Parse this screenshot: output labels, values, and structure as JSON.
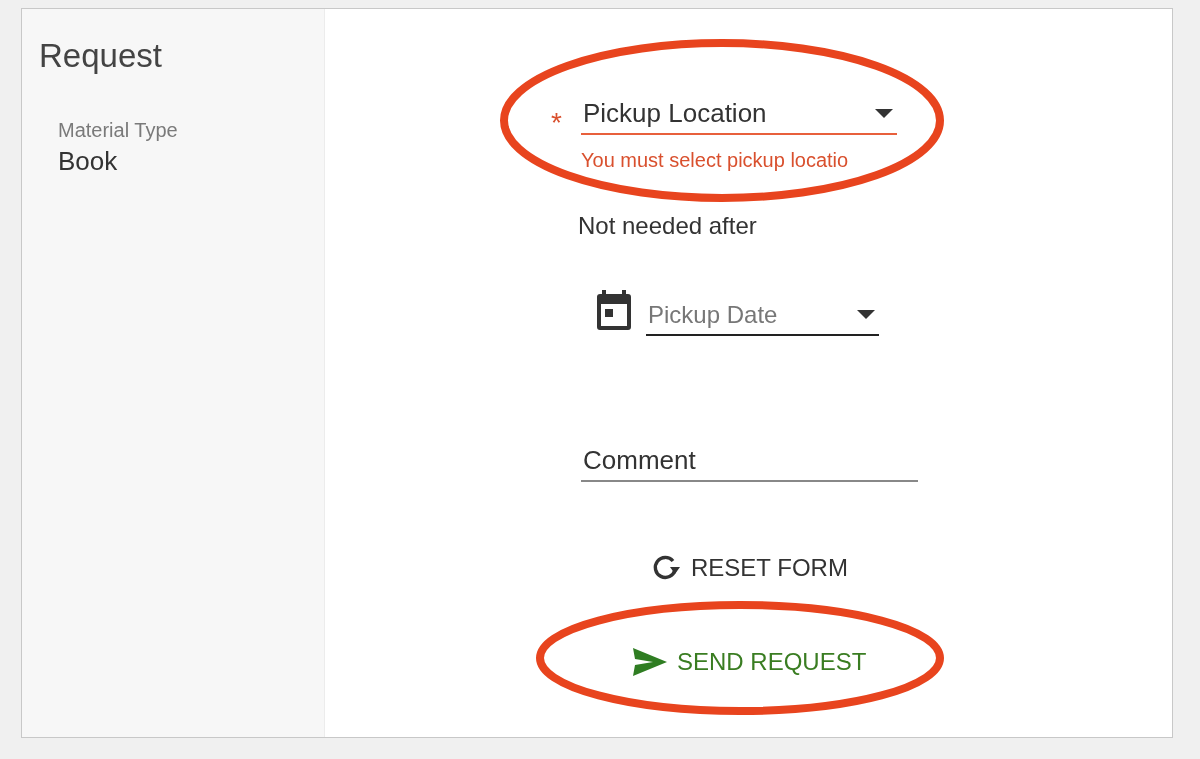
{
  "sidebar": {
    "title": "Request",
    "fields": [
      {
        "label": "Material Type",
        "value": "Book"
      }
    ]
  },
  "form": {
    "fields": [
      {
        "kind": "select",
        "placeholder": "Pickup Location",
        "required_mark": "*",
        "error": "You must select pickup locatio",
        "circled": true
      },
      {
        "kind": "heading",
        "label": "Not needed after"
      },
      {
        "kind": "date",
        "placeholder": "Pickup Date"
      },
      {
        "kind": "text",
        "placeholder": "Comment"
      }
    ],
    "buttons": [
      {
        "kind": "reset",
        "label": "RESET FORM"
      },
      {
        "kind": "send",
        "label": "SEND REQUEST",
        "circled": true
      }
    ]
  }
}
